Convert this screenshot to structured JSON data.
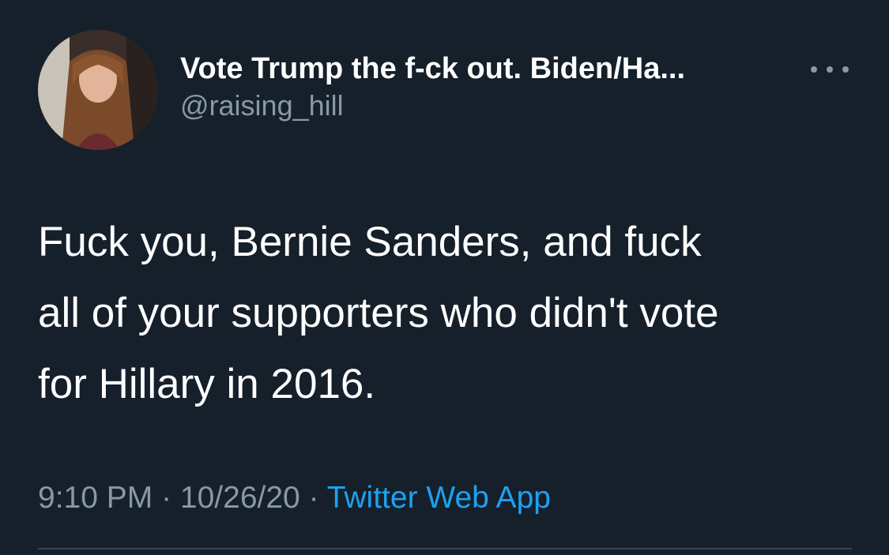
{
  "theme": {
    "background": "#15202b",
    "text_primary": "#ffffff",
    "text_secondary": "#8899a6",
    "link_color": "#1da1f2",
    "divider": "#38444d"
  },
  "author": {
    "avatar_icon": "user-avatar-photo",
    "display_name": "Vote Trump the f-ck out. Biden/Ha...",
    "handle": "@raising_hill"
  },
  "more_menu_icon": "more-horizontal-icon",
  "tweet": {
    "text": "Fuck you, Bernie Sanders, and fuck\nall of your supporters who didn't vote\nfor Hillary in 2016."
  },
  "meta": {
    "time": "9:10 PM",
    "separator_1": " · ",
    "date": "10/26/20",
    "separator_2": " · ",
    "source": "Twitter Web App"
  }
}
